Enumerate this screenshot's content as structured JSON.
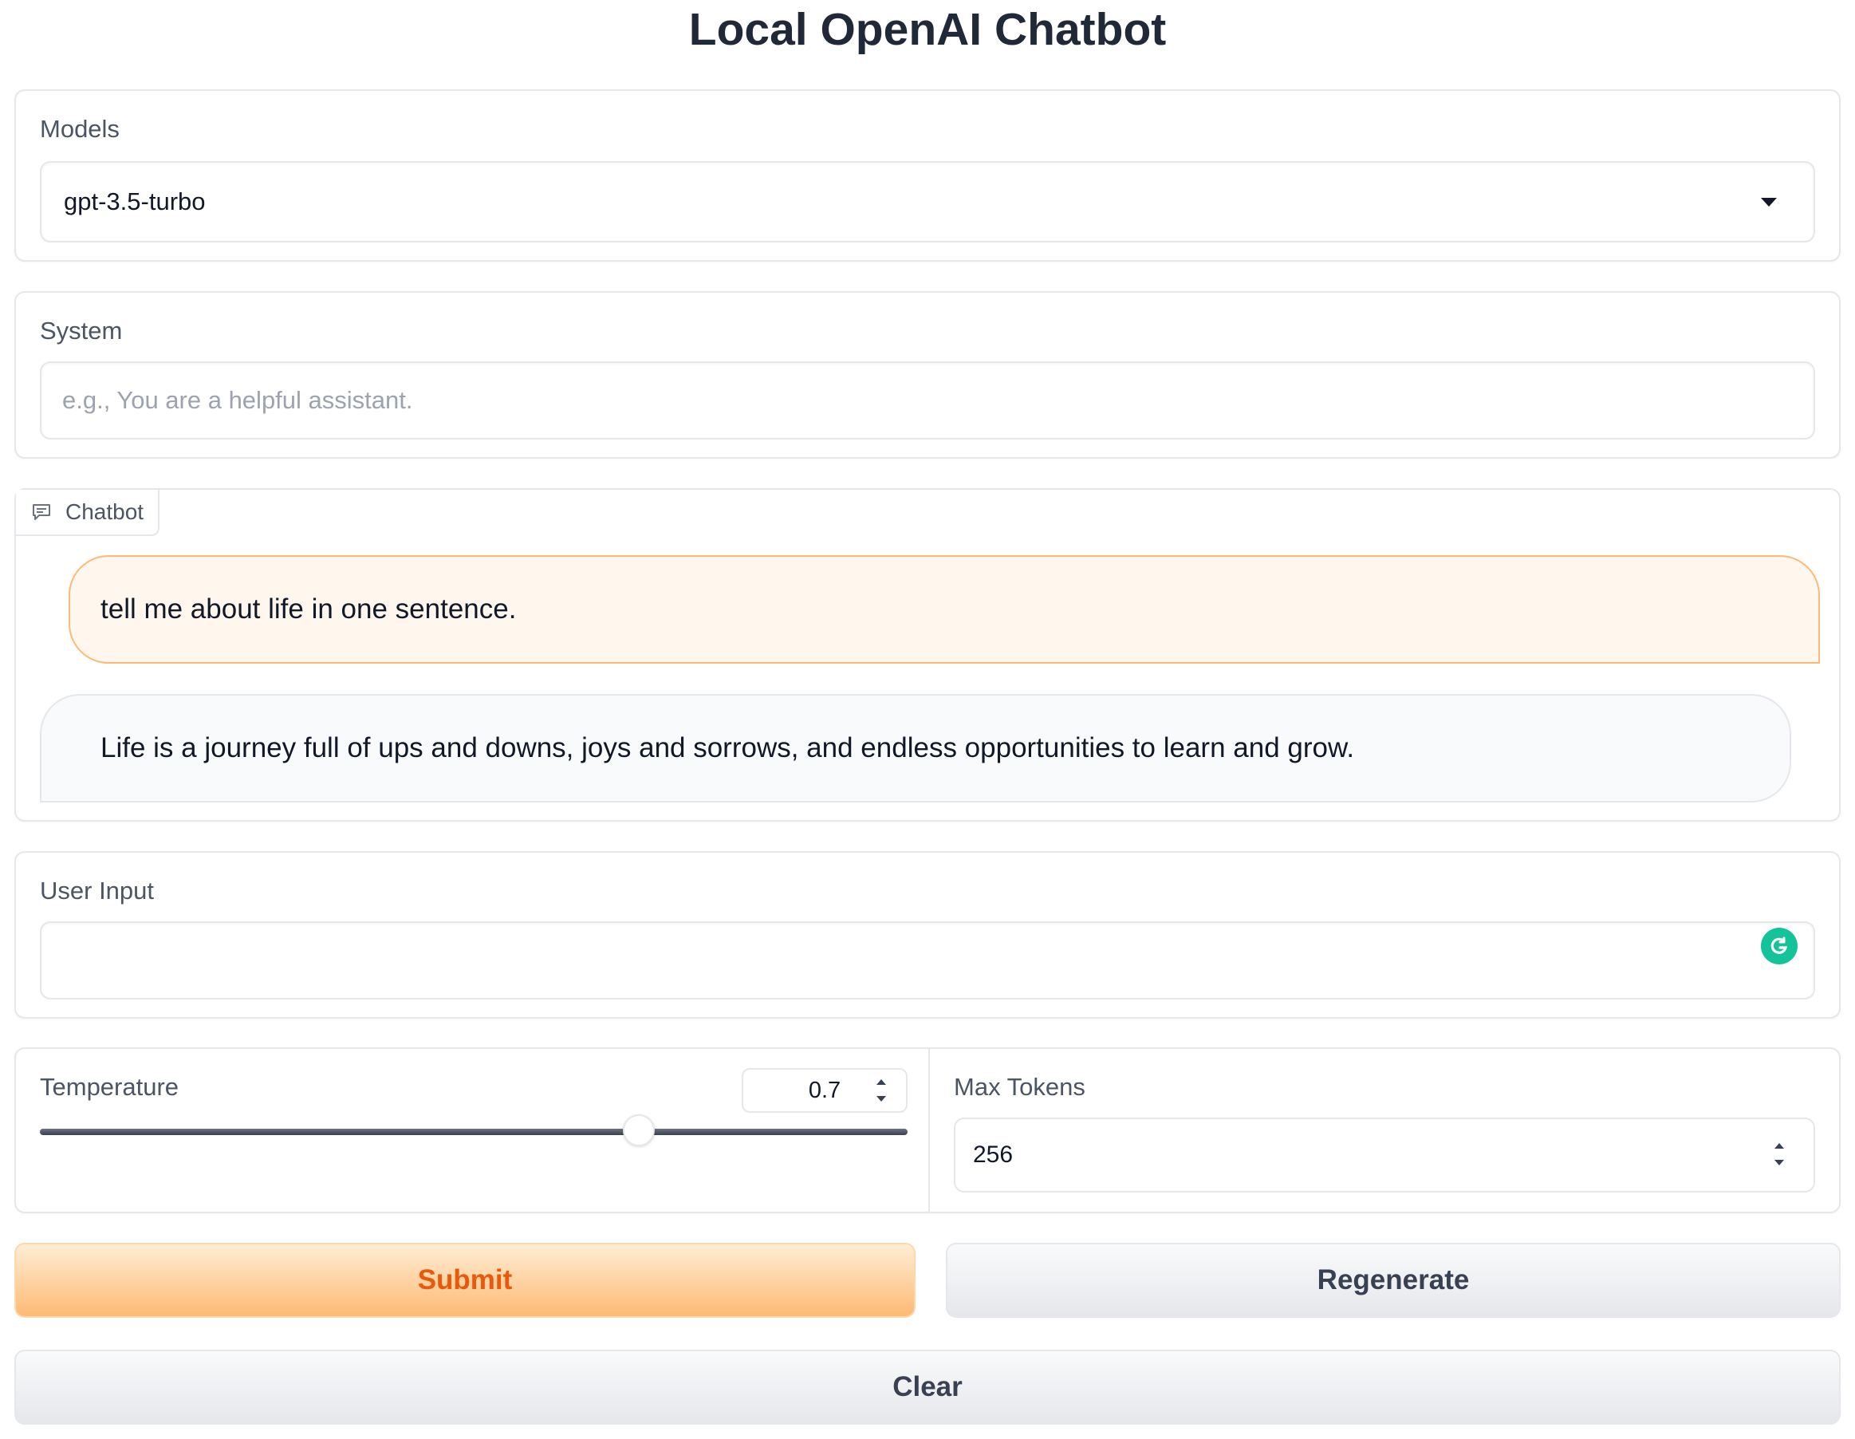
{
  "app": {
    "title": "Local OpenAI Chatbot"
  },
  "models": {
    "label": "Models",
    "selected": "gpt-3.5-turbo",
    "icon": "chevron-down-icon"
  },
  "system": {
    "label": "System",
    "value": "",
    "placeholder": "e.g., You are a helpful assistant."
  },
  "chatbot": {
    "tab_label": "Chatbot",
    "tab_icon": "chat-icon",
    "messages": [
      {
        "role": "user",
        "text": "tell me about life in one sentence."
      },
      {
        "role": "assistant",
        "text": "Life is a journey full of ups and downs, joys and sorrows, and endless opportunities to learn and grow."
      }
    ]
  },
  "user_input": {
    "label": "User Input",
    "value": "",
    "placeholder": "",
    "extension_icon": "grammarly-icon"
  },
  "temperature": {
    "label": "Temperature",
    "value": "0.7",
    "min": 0,
    "max": 1,
    "slider_fraction": 0.69
  },
  "max_tokens": {
    "label": "Max Tokens",
    "value": "256"
  },
  "buttons": {
    "submit": "Submit",
    "regenerate": "Regenerate",
    "clear": "Clear"
  },
  "colors": {
    "accent": "#ea580c",
    "user_bubble_bg": "#fff7ed",
    "user_bubble_border": "#fdba74",
    "grammarly": "#15c39a"
  }
}
